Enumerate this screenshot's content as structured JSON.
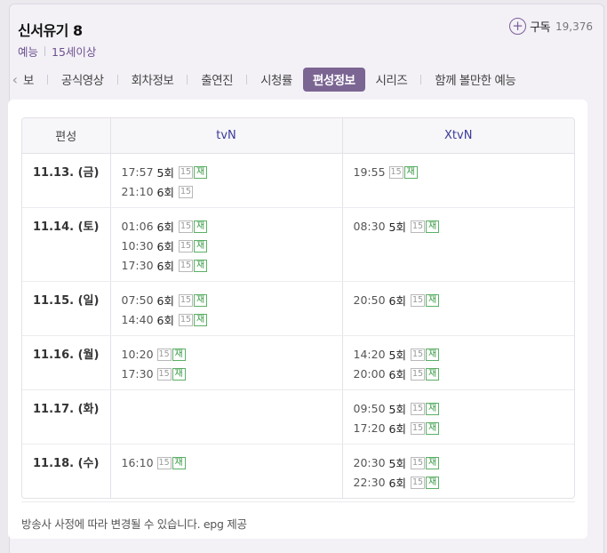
{
  "program": {
    "title": "신서유기 8",
    "genre": "예능",
    "rating": "15세이상",
    "subscribe_label": "구독",
    "subscribe_count": "19,376"
  },
  "tabs": [
    {
      "label": "방송정보",
      "visible_text": "보",
      "active": false
    },
    {
      "label": "공식영상",
      "active": false
    },
    {
      "label": "회차정보",
      "active": false
    },
    {
      "label": "출연진",
      "active": false
    },
    {
      "label": "시청률",
      "active": false
    },
    {
      "label": "편성정보",
      "active": true
    },
    {
      "label": "시리즈",
      "active": false
    },
    {
      "label": "함께 볼만한 예능",
      "active": false
    }
  ],
  "schedule": {
    "header_date": "편성",
    "channels": [
      "tvN",
      "XtvN"
    ],
    "rows": [
      {
        "date": "11.13. (금)",
        "tvn": [
          {
            "time": "17:57",
            "ep": "5회",
            "rate": "15",
            "re": "재"
          },
          {
            "time": "21:10",
            "ep": "6회",
            "rate": "15",
            "re": ""
          }
        ],
        "xtvn": [
          {
            "time": "19:55",
            "ep": "",
            "rate": "15",
            "re": "재"
          }
        ]
      },
      {
        "date": "11.14. (토)",
        "tvn": [
          {
            "time": "01:06",
            "ep": "6회",
            "rate": "15",
            "re": "재"
          },
          {
            "time": "10:30",
            "ep": "6회",
            "rate": "15",
            "re": "재"
          },
          {
            "time": "17:30",
            "ep": "6회",
            "rate": "15",
            "re": "재"
          }
        ],
        "xtvn": [
          {
            "time": "08:30",
            "ep": "5회",
            "rate": "15",
            "re": "재"
          }
        ]
      },
      {
        "date": "11.15. (일)",
        "tvn": [
          {
            "time": "07:50",
            "ep": "6회",
            "rate": "15",
            "re": "재"
          },
          {
            "time": "14:40",
            "ep": "6회",
            "rate": "15",
            "re": "재"
          }
        ],
        "xtvn": [
          {
            "time": "20:50",
            "ep": "6회",
            "rate": "15",
            "re": "재"
          }
        ]
      },
      {
        "date": "11.16. (월)",
        "tvn": [
          {
            "time": "10:20",
            "ep": "",
            "rate": "15",
            "re": "재"
          },
          {
            "time": "17:30",
            "ep": "",
            "rate": "15",
            "re": "재"
          }
        ],
        "xtvn": [
          {
            "time": "14:20",
            "ep": "5회",
            "rate": "15",
            "re": "재"
          },
          {
            "time": "20:00",
            "ep": "6회",
            "rate": "15",
            "re": "재"
          }
        ]
      },
      {
        "date": "11.17. (화)",
        "tvn": [],
        "xtvn": [
          {
            "time": "09:50",
            "ep": "5회",
            "rate": "15",
            "re": "재"
          },
          {
            "time": "17:20",
            "ep": "6회",
            "rate": "15",
            "re": "재"
          }
        ]
      },
      {
        "date": "11.18. (수)",
        "tvn": [
          {
            "time": "16:10",
            "ep": "",
            "rate": "15",
            "re": "재"
          }
        ],
        "xtvn": [
          {
            "time": "20:30",
            "ep": "5회",
            "rate": "15",
            "re": "재"
          },
          {
            "time": "22:30",
            "ep": "6회",
            "rate": "15",
            "re": "재"
          }
        ]
      }
    ]
  },
  "footer": "방송사 사정에 따라 변경될 수 있습니다. epg 제공",
  "icons": {
    "subscribe": "plus-circle-icon",
    "tab_prev": "chevron-left-icon"
  },
  "colors": {
    "accent": "#7b6592",
    "channel": "#3b3b9a",
    "rerun": "#3a9a46"
  }
}
